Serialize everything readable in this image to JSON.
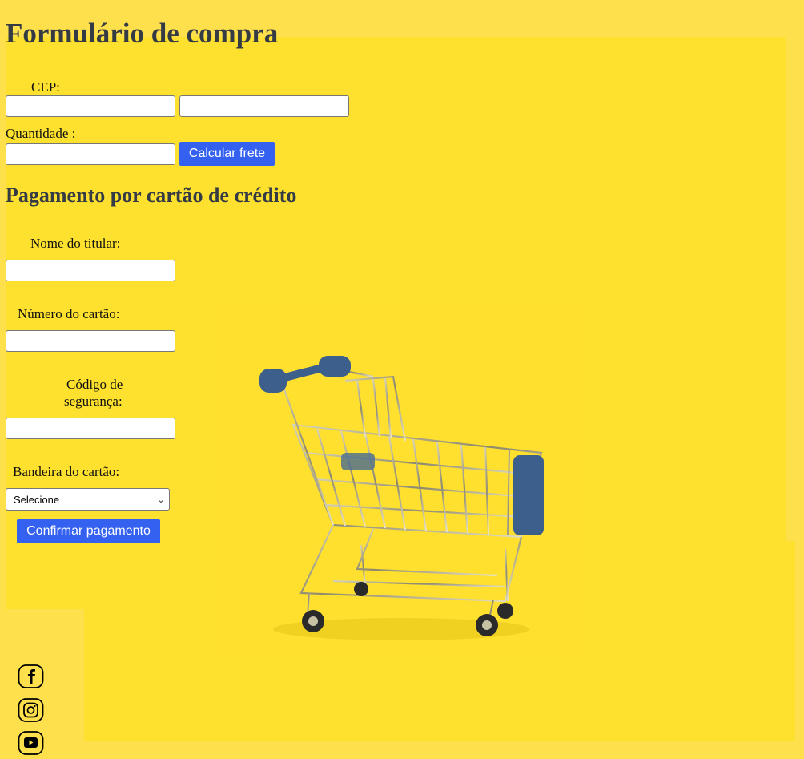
{
  "page": {
    "title": "Formulário de compra"
  },
  "shipping": {
    "cep_label": "CEP:",
    "cep_value_1": "",
    "cep_value_2": "",
    "quantity_label": "Quantidade :",
    "quantity_value": "",
    "calc_button": "Calcular frete"
  },
  "payment": {
    "title": "Pagamento por cartão de crédito",
    "holder_label": "Nome do titular:",
    "holder_value": "",
    "card_number_label": "Número do cartão:",
    "card_number_value": "",
    "security_label_line1": "Código de",
    "security_label_line2": "segurança:",
    "security_value": "",
    "brand_label": "Bandeira do cartão:",
    "brand_selected": "Selecione",
    "confirm_button": "Confirmar pagamento"
  },
  "image": {
    "subject": "shopping-cart-photo"
  },
  "social_icons": [
    "facebook-icon",
    "instagram-icon",
    "youtube-icon"
  ],
  "colors": {
    "background": "#fee04c",
    "panel": "#fee12e",
    "heading": "#353b44",
    "button": "#3461f0"
  }
}
